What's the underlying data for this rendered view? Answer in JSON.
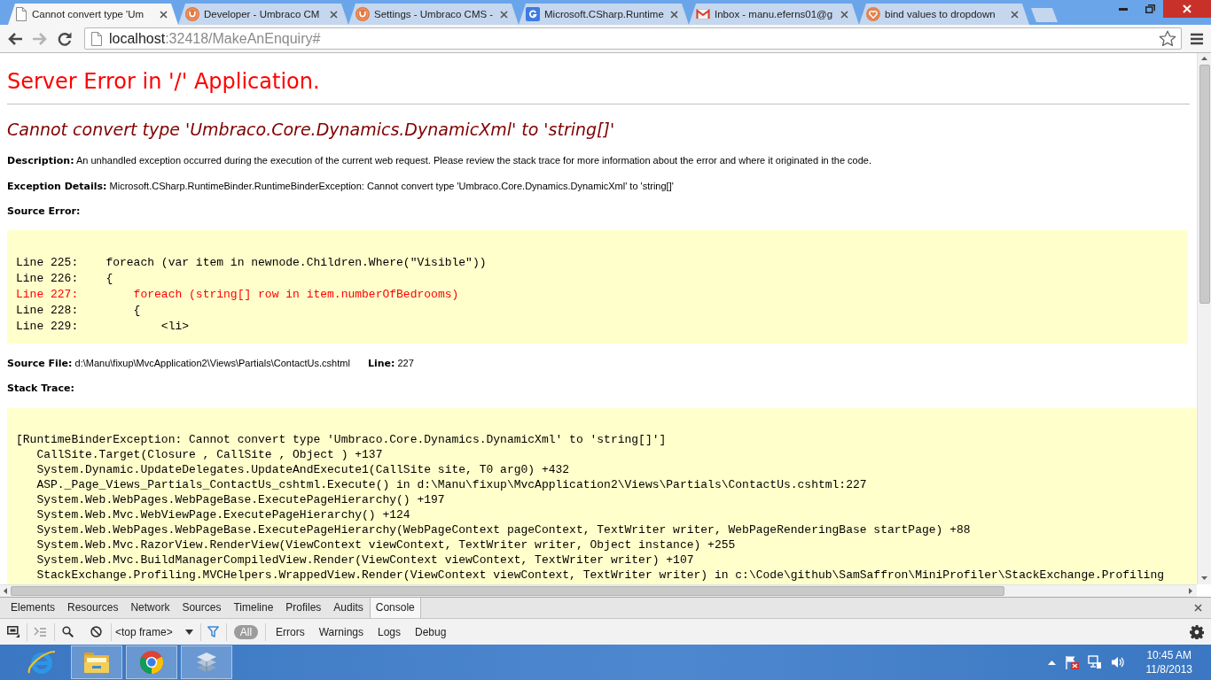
{
  "browser": {
    "tabs": [
      {
        "kind": "page",
        "title": "Cannot convert type 'Um",
        "selected": true
      },
      {
        "kind": "ring",
        "title": "Developer - Umbraco CM",
        "selected": false
      },
      {
        "kind": "ring",
        "title": "Settings - Umbraco CMS -",
        "selected": false
      },
      {
        "kind": "google",
        "title": "Microsoft.CSharp.Runtime",
        "selected": false
      },
      {
        "kind": "mail",
        "title": "Inbox - manu.eferns01@g",
        "selected": false
      },
      {
        "kind": "heart",
        "title": "bind values to dropdown",
        "selected": false
      }
    ],
    "nav": [
      {
        "kind": "back",
        "disabled": false
      },
      {
        "kind": "forward",
        "disabled": true
      },
      {
        "kind": "reload",
        "disabled": false
      }
    ],
    "address": {
      "host": "localhost",
      "rest": ":32418/MakeAnEnquiry#"
    }
  },
  "page": {
    "title": "Server Error in '/' Application.",
    "error": "Cannot convert type 'Umbraco.Core.Dynamics.DynamicXml' to 'string[]'",
    "description": "**Description:** An unhandled exception occurred during the execution of the current web request. Please review the stack trace for more information about the error and where it originated in the code.",
    "exception_details": "**Exception Details:** Microsoft.CSharp.RuntimeBinder.RuntimeBinderException: Cannot convert type 'Umbraco.Core.Dynamics.DynamicXml' to 'string[]'",
    "source_error": {
      "label": "Source Error:",
      "lines": [
        {
          "text": "Line 225:    foreach (var item in newnode.Children.Where(\"Visible\"))",
          "highlighted": false
        },
        {
          "text": "Line 226:    {",
          "highlighted": false
        },
        {
          "text": "Line 227:        foreach (string[] row in item.numberOfBedrooms)",
          "highlighted": true
        },
        {
          "text": "Line 228:        {",
          "highlighted": false
        },
        {
          "text": "Line 229:            <li>",
          "highlighted": false
        }
      ]
    },
    "source_file": {
      "file": "**Source File:** d:\\Manu\\fixup\\MvcApplication2\\Views\\Partials\\ContactUs.cshtml",
      "line": "**Line:** 227"
    },
    "stack_trace": {
      "label": "Stack Trace:",
      "exception": "[RuntimeBinderException: Cannot convert type 'Umbraco.Core.Dynamics.DynamicXml' to 'string[]']",
      "frames": [
        "CallSite.Target(Closure , CallSite , Object ) +137",
        "System.Dynamic.UpdateDelegates.UpdateAndExecute1(CallSite site, T0 arg0) +432",
        "ASP._Page_Views_Partials_ContactUs_cshtml.Execute() in d:\\Manu\\fixup\\MvcApplication2\\Views\\Partials\\ContactUs.cshtml:227",
        "System.Web.WebPages.WebPageBase.ExecutePageHierarchy() +197",
        "System.Web.Mvc.WebViewPage.ExecutePageHierarchy() +124",
        "System.Web.WebPages.WebPageBase.ExecutePageHierarchy(WebPageContext pageContext, TextWriter writer, WebPageRenderingBase startPage) +88",
        "System.Web.Mvc.RazorView.RenderView(ViewContext viewContext, TextWriter writer, Object instance) +255",
        "System.Web.Mvc.BuildManagerCompiledView.Render(ViewContext viewContext, TextWriter writer) +107",
        "StackExchange.Profiling.MVCHelpers.WrappedView.Render(ViewContext viewContext, TextWriter writer) in c:\\Code\\github\\SamSaffron\\MiniProfiler\\StackExchange.Profiling"
      ]
    }
  },
  "devtools": {
    "tabs": [
      {
        "label": "Elements",
        "selected": false
      },
      {
        "label": "Resources",
        "selected": false
      },
      {
        "label": "Network",
        "selected": false
      },
      {
        "label": "Sources",
        "selected": false
      },
      {
        "label": "Timeline",
        "selected": false
      },
      {
        "label": "Profiles",
        "selected": false
      },
      {
        "label": "Audits",
        "selected": false
      },
      {
        "label": "Console",
        "selected": true
      }
    ],
    "frame": "<top frame>",
    "filters": [
      {
        "label": "All",
        "selected": true
      },
      {
        "label": "Errors",
        "selected": false
      },
      {
        "label": "Warnings",
        "selected": false
      },
      {
        "label": "Logs",
        "selected": false
      },
      {
        "label": "Debug",
        "selected": false
      }
    ]
  },
  "taskbar": {
    "apps": [
      {
        "kind": "ie",
        "running": false
      },
      {
        "kind": "folder",
        "running": true
      },
      {
        "kind": "chrome",
        "running": true
      },
      {
        "kind": "stack",
        "running": true
      }
    ],
    "clock": {
      "time": "10:45 AM",
      "date": "11/8/2013"
    }
  }
}
